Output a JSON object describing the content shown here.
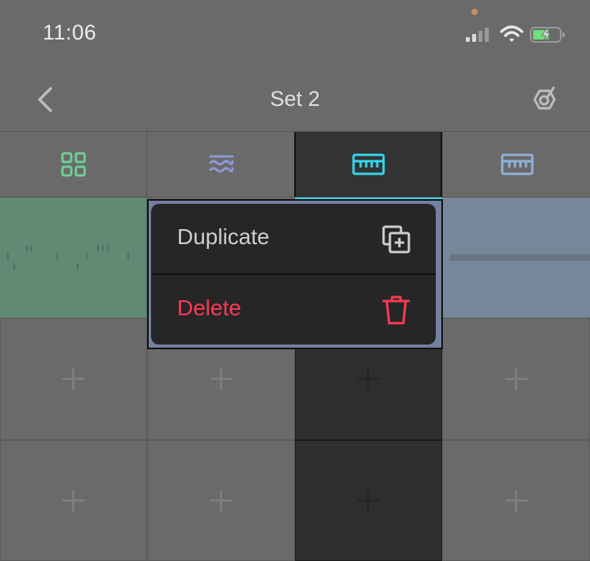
{
  "status_bar": {
    "time": "11:06"
  },
  "nav": {
    "title": "Set 2"
  },
  "tracks": [
    {
      "name": "drum-rack",
      "icon": "grid-icon",
      "color": "#6fcf95"
    },
    {
      "name": "synth",
      "icon": "waves-icon",
      "color": "#8d98d6"
    },
    {
      "name": "keys-selected",
      "icon": "keyboard-icon",
      "color": "#34d6ec"
    },
    {
      "name": "keys",
      "icon": "keyboard-icon",
      "color": "#8fb2d6"
    }
  ],
  "context_menu": {
    "items": [
      {
        "label": "Duplicate",
        "icon": "duplicate-icon",
        "color": "#cfcfcf"
      },
      {
        "label": "Delete",
        "icon": "trash-icon",
        "color": "#ff3a55"
      }
    ]
  },
  "colors": {
    "accent": "#34d6ec",
    "delete": "#ff3a55",
    "clip_green": "#608a73",
    "clip_blue": "#76879a"
  }
}
